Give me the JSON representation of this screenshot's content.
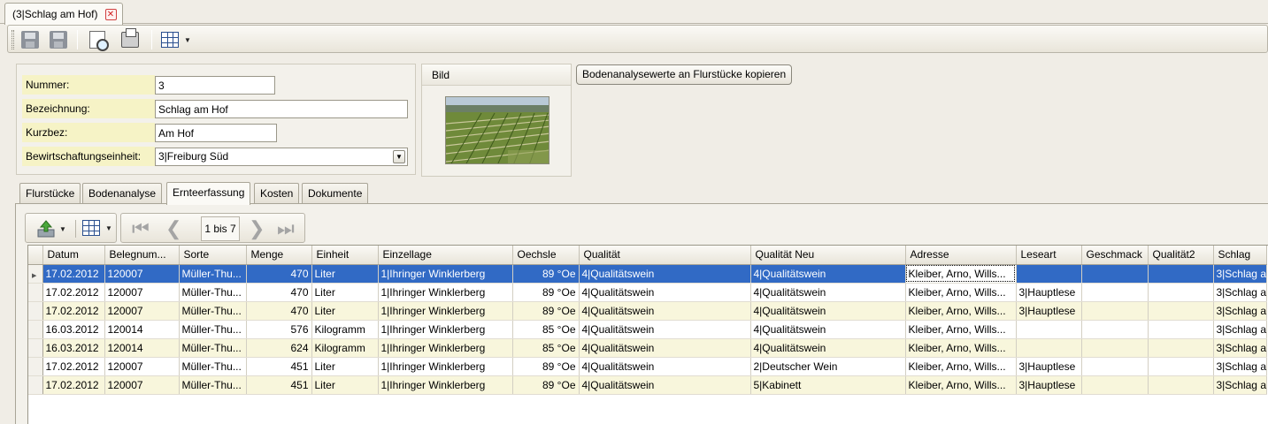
{
  "document_tab": {
    "title": "(3|Schlag am Hof)",
    "close_glyph": "✕"
  },
  "toolbar": {
    "buttons": [
      {
        "name": "save-close-icon"
      },
      {
        "name": "save-icon"
      },
      {
        "name": "print-preview-icon"
      },
      {
        "name": "print-icon"
      },
      {
        "name": "grid-layout-icon"
      }
    ]
  },
  "form": {
    "nummer_label": "Nummer:",
    "nummer_value": "3",
    "bezeichnung_label": "Bezeichnung:",
    "bezeichnung_value": "Schlag am Hof",
    "kurzbez_label": "Kurzbez:",
    "kurzbez_value": "Am Hof",
    "bewirtschaftung_label": "Bewirtschaftungseinheit:",
    "bewirtschaftung_value": "3|Freiburg Süd"
  },
  "bild": {
    "header": "Bild"
  },
  "copy_button": "Bodenanalysewerte an Flurstücke kopieren",
  "tabs": [
    "Flurstücke",
    "Bodenanalyse",
    "Ernteerfassung",
    "Kosten",
    "Dokumente"
  ],
  "active_tab": "Ernteerfassung",
  "grid_toolbar": {
    "page_label": "1 bis 7"
  },
  "grid": {
    "columns": [
      "Datum",
      "Belegnum...",
      "Sorte",
      "Menge",
      "Einheit",
      "Einzellage",
      "Oechsle",
      "Qualität",
      "Qualität Neu",
      "Adresse",
      "Leseart",
      "Geschmack",
      "Qualität2",
      "Schlag"
    ],
    "rows": [
      [
        "17.02.2012",
        "120007",
        "Müller-Thu...",
        "470",
        "Liter",
        "1|Ihringer Winklerberg",
        "89 °Oe",
        "4|Qualitätswein",
        "4|Qualitätswein",
        "Kleiber, Arno, Wills...",
        "",
        "",
        "",
        "3|Schlag a"
      ],
      [
        "17.02.2012",
        "120007",
        "Müller-Thu...",
        "470",
        "Liter",
        "1|Ihringer Winklerberg",
        "89 °Oe",
        "4|Qualitätswein",
        "4|Qualitätswein",
        "Kleiber, Arno, Wills...",
        "3|Hauptlese",
        "",
        "",
        "3|Schlag a"
      ],
      [
        "17.02.2012",
        "120007",
        "Müller-Thu...",
        "470",
        "Liter",
        "1|Ihringer Winklerberg",
        "89 °Oe",
        "4|Qualitätswein",
        "4|Qualitätswein",
        "Kleiber, Arno, Wills...",
        "3|Hauptlese",
        "",
        "",
        "3|Schlag a"
      ],
      [
        "16.03.2012",
        "120014",
        "Müller-Thu...",
        "576",
        "Kilogramm",
        "1|Ihringer Winklerberg",
        "85 °Oe",
        "4|Qualitätswein",
        "4|Qualitätswein",
        "Kleiber, Arno, Wills...",
        "",
        "",
        "",
        "3|Schlag a"
      ],
      [
        "16.03.2012",
        "120014",
        "Müller-Thu...",
        "624",
        "Kilogramm",
        "1|Ihringer Winklerberg",
        "85 °Oe",
        "4|Qualitätswein",
        "4|Qualitätswein",
        "Kleiber, Arno, Wills...",
        "",
        "",
        "",
        "3|Schlag a"
      ],
      [
        "17.02.2012",
        "120007",
        "Müller-Thu...",
        "451",
        "Liter",
        "1|Ihringer Winklerberg",
        "89 °Oe",
        "4|Qualitätswein",
        "2|Deutscher Wein",
        "Kleiber, Arno, Wills...",
        "3|Hauptlese",
        "",
        "",
        "3|Schlag a"
      ],
      [
        "17.02.2012",
        "120007",
        "Müller-Thu...",
        "451",
        "Liter",
        "1|Ihringer Winklerberg",
        "89 °Oe",
        "4|Qualitätswein",
        "5|Kabinett",
        "Kleiber, Arno, Wills...",
        "3|Hauptlese",
        "",
        "",
        "3|Schlag a"
      ]
    ],
    "selected_row": 0
  },
  "colors": {
    "selection": "#316ac5",
    "label_bg": "#f6f3c6",
    "alt_row": "#f8f6dc",
    "chrome": "#f0ede6"
  }
}
